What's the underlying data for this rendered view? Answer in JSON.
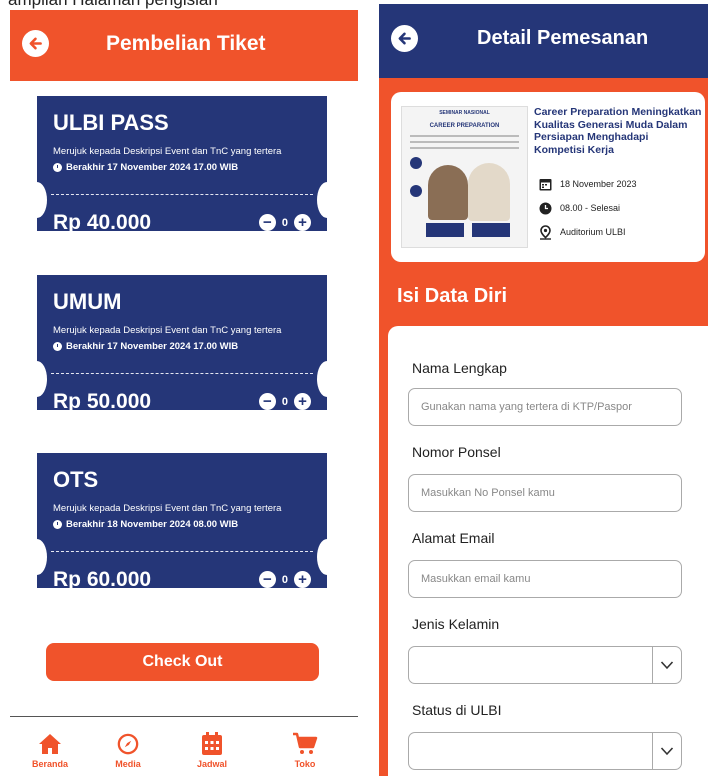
{
  "caption": "ampilan Halaman pengisian",
  "left": {
    "header_title": "Pembelian Tiket",
    "tickets": [
      {
        "name": "ULBI PASS",
        "desc": "Merujuk kepada Deskripsi Event dan TnC yang tertera",
        "deadline": "Berakhir 17 November 2024 17.00 WIB",
        "price": "Rp 40.000",
        "qty": "0"
      },
      {
        "name": "UMUM",
        "desc": "Merujuk kepada Deskripsi Event dan TnC yang tertera",
        "deadline": "Berakhir 17 November 2024 17.00 WIB",
        "price": "Rp 50.000",
        "qty": "0"
      },
      {
        "name": "OTS",
        "desc": "Merujuk kepada Deskripsi Event dan TnC yang tertera",
        "deadline": "Berakhir 18 November 2024 08.00 WIB",
        "price": "Rp 60.000",
        "qty": "0"
      }
    ],
    "checkout_label": "Check Out",
    "nav": [
      {
        "label": "Beranda",
        "icon": "home-icon"
      },
      {
        "label": "Media",
        "icon": "compass-icon"
      },
      {
        "label": "Jadwal",
        "icon": "calendar-icon"
      },
      {
        "label": "Toko",
        "icon": "cart-icon"
      }
    ]
  },
  "right": {
    "header_title": "Detail Pemesanan",
    "event": {
      "poster_top": "SEMINAR NASIONAL",
      "poster_title": "CAREER PREPARATION",
      "title": "Career Preparation Meningkatkan Kualitas Generasi Muda Dalam Persiapan Menghadapi Kompetisi Kerja",
      "date": "18 November 2023",
      "time": "08.00 - Selesai",
      "location": "Auditorium ULBI"
    },
    "section_title": "Isi Data Diri",
    "form": {
      "name_label": "Nama Lengkap",
      "name_placeholder": "Gunakan nama yang tertera di KTP/Paspor",
      "phone_label": "Nomor Ponsel",
      "phone_placeholder": "Masukkan No Ponsel kamu",
      "email_label": "Alamat Email",
      "email_placeholder": "Masukkan email kamu",
      "gender_label": "Jenis Kelamin",
      "status_label": "Status di ULBI"
    }
  },
  "colors": {
    "orange": "#f0532b",
    "navy": "#253678"
  }
}
